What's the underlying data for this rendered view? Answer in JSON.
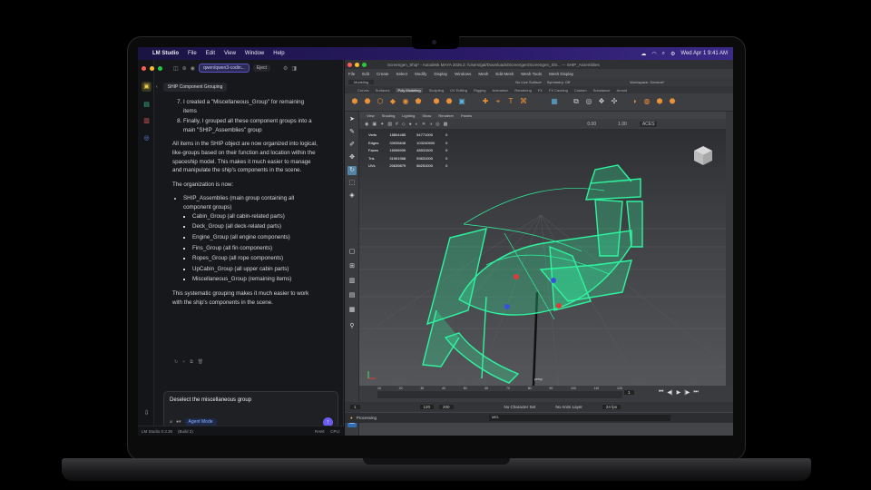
{
  "menubar": {
    "app": "LM Studio",
    "items": [
      "File",
      "Edit",
      "View",
      "Window",
      "Help"
    ],
    "datetime": "Wed Apr 1  9:41 AM"
  },
  "lm": {
    "model_pill": "qwen/qwen3-codin...",
    "eject": "Eject",
    "chat_tab": "SHIP Component Grouping",
    "ordered": [
      "I created a \"Miscellaneous_Group\" for remaining items",
      "Finally, I grouped all these component groups into a main \"SHIP_Assemblies\" group"
    ],
    "para1": "All items in the SHIP object are now organized into logical, like-groups based on their function and location within the spaceship model. This makes it much easier to manage and manipulate the ship's components in the scene.",
    "para2": "The organization is now:",
    "top_item": "SHIP_Assemblies (main group containing all component groups)",
    "sub_items": [
      "Cabin_Group (all cabin-related parts)",
      "Deck_Group (all deck-related parts)",
      "Engine_Group (all engine components)",
      "Fins_Group (all fin components)",
      "Ropes_Group (all rope components)",
      "UpCabin_Group (all upper cabin parts)",
      "Miscellaneous_Group (remaining items)"
    ],
    "para3": "This systematic grouping makes it much easier to work with the ship's components in the scene.",
    "composer_text": "Deselect the miscellaneous group",
    "composer_mode": "Agent Mode",
    "status_app": "LM Studio 0.3.36",
    "status_build": "(Build 2)",
    "status_ram": "RAM:",
    "status_cpu": "CPU:"
  },
  "maya": {
    "title": "Screengen_Ship* - Autodesk MAYA 2026.2: /Users/gal/Downloads/Screengen/Screengen_Shi...   ---   SHIP_Assemblies",
    "menus": [
      "File",
      "Edit",
      "Create",
      "Select",
      "Modify",
      "Display",
      "Windows",
      "Mesh",
      "Edit Mesh",
      "Mesh Tools",
      "Mesh Display"
    ],
    "workspace": "Workspace: General*",
    "mode": "Modeling",
    "live": "No Live Surface",
    "symmetry": "Symmetry: Off",
    "shelf_tabs": [
      "Curves",
      "Surfaces",
      "Poly Modeling",
      "Sculpting",
      "UV Editing",
      "Rigging",
      "Animation",
      "Rendering",
      "FX",
      "FX Caching",
      "Custom",
      "Substance",
      "Arnold"
    ],
    "vp_menus": [
      "View",
      "Shading",
      "Lighting",
      "Show",
      "Renderer",
      "Panels"
    ],
    "hud_rows": [
      [
        "Verts",
        "18804485",
        "54771000",
        "0"
      ],
      [
        "Edges",
        "33935848",
        "103240500",
        "0"
      ],
      [
        "Faces",
        "16096909",
        "48531500",
        "0"
      ],
      [
        "Tris",
        "31901968",
        "93631000",
        "0"
      ],
      [
        "UVs",
        "20639879",
        "56251000",
        "0"
      ]
    ],
    "vp_value1": "0.00",
    "vp_value2": "1.00",
    "vp_colorspace": "ACES",
    "persp": "persp",
    "timeline_ticks": [
      "10",
      "20",
      "30",
      "40",
      "50",
      "60",
      "70",
      "80",
      "90",
      "100",
      "110",
      "120"
    ],
    "current_frame": "1",
    "range_start": "1",
    "range_end": "200",
    "playback_end": "120",
    "char_set": "No Character Set",
    "anim_layer": "No Anim Layer",
    "fps": "24 fps",
    "cmd_label": "Processing",
    "cmd_mel": "MEL"
  },
  "colors": {
    "accent": "#6b5cf0",
    "wireframe": "#2df5a0",
    "lm_bg": "#17181b",
    "maya_bg": "#444548"
  }
}
